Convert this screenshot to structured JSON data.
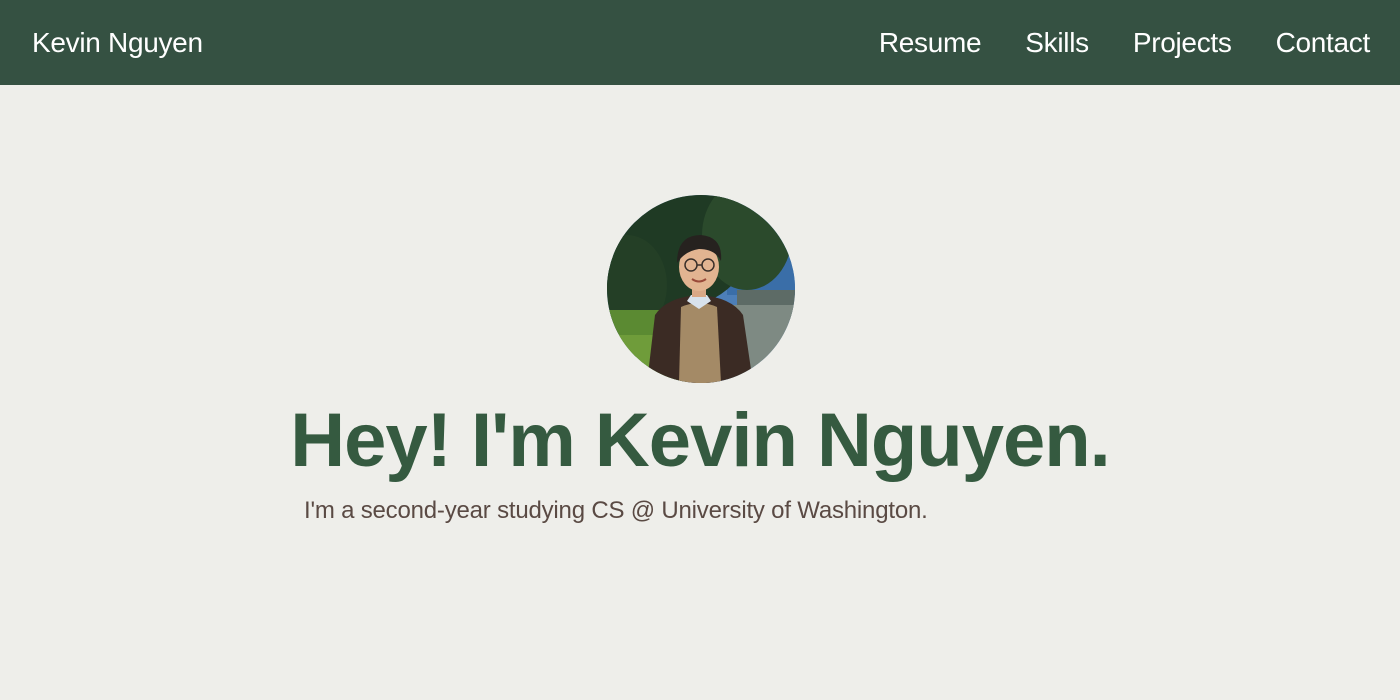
{
  "nav": {
    "brand": "Kevin Nguyen",
    "links": [
      {
        "label": "Resume"
      },
      {
        "label": "Skills"
      },
      {
        "label": "Projects"
      },
      {
        "label": "Contact"
      }
    ]
  },
  "hero": {
    "title": "Hey! I'm Kevin Nguyen.",
    "subtitle": "I'm a second-year studying CS @ University of Washington."
  },
  "colors": {
    "navbar": "#355142",
    "page_background": "#eeeeea",
    "title": "#355a40",
    "subtitle": "#5a4a44"
  }
}
